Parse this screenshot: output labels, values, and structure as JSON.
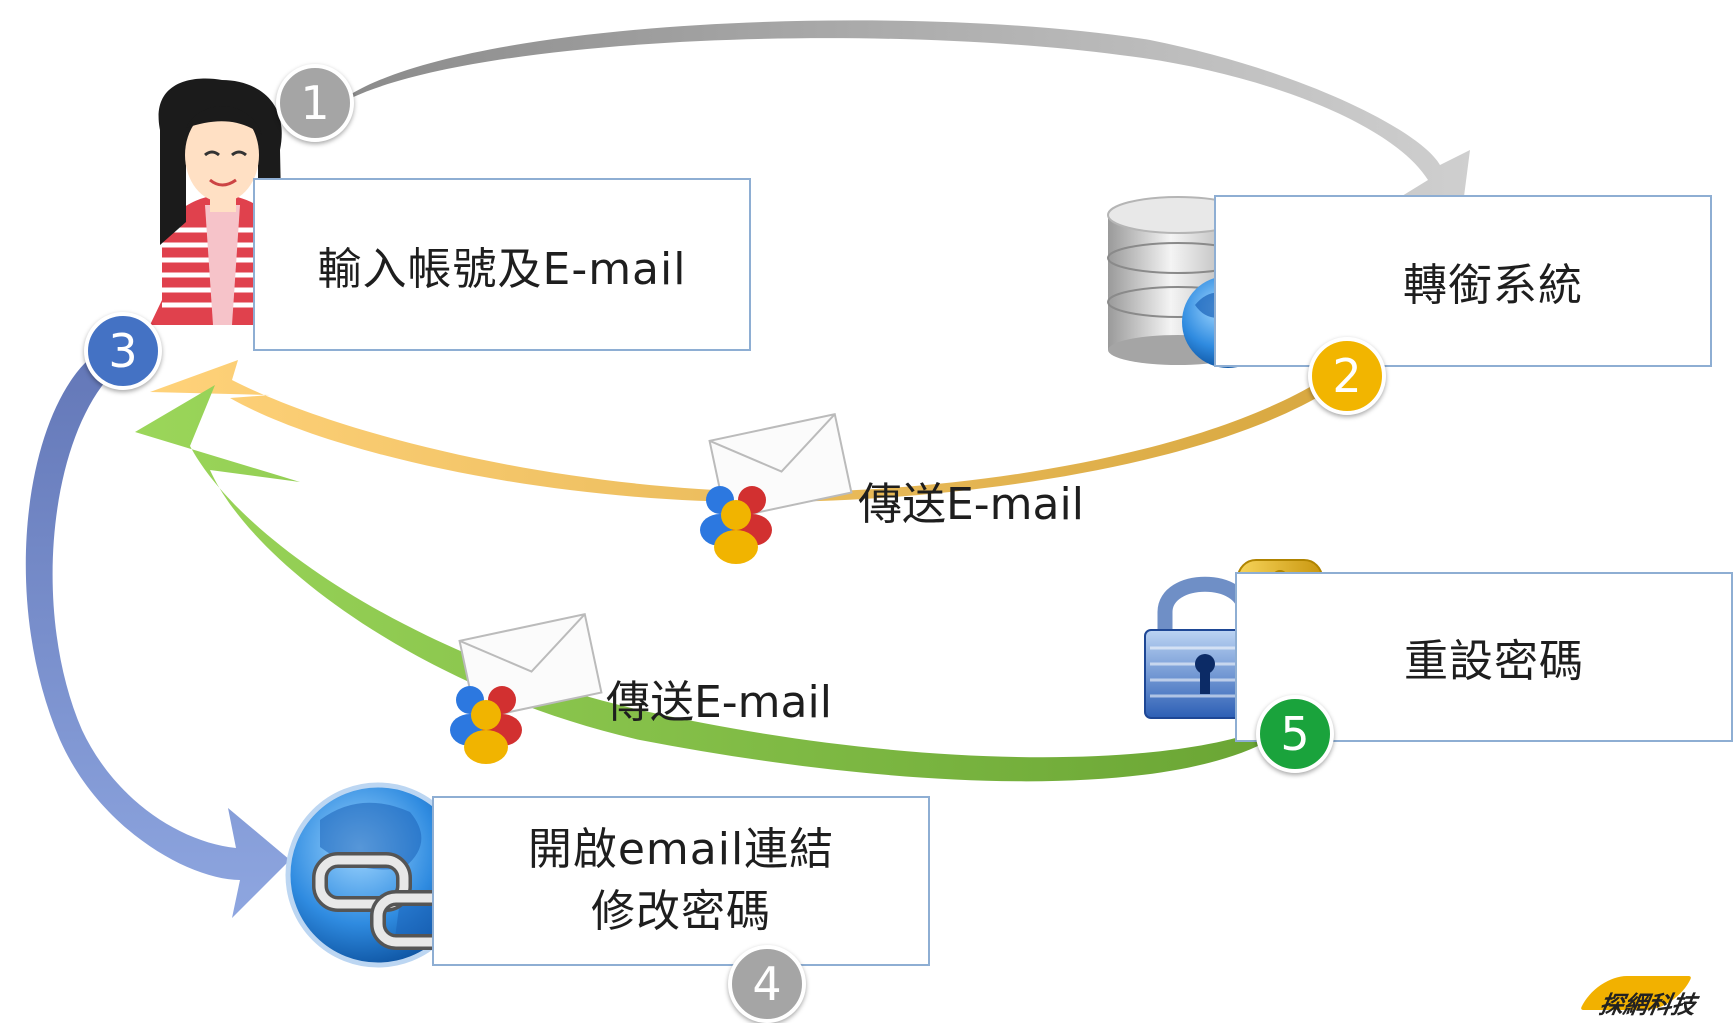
{
  "boxes": {
    "input": "輸入帳號及E-mail",
    "forward": "轉銜系統",
    "open_line1": "開啟email連結",
    "open_line2": "修改密碼",
    "reset": "重設密碼"
  },
  "arrow_labels": {
    "send_top": "傳送E-mail",
    "send_bottom": "傳送E-mail"
  },
  "steps": {
    "s1": "1",
    "s2": "2",
    "s3": "3",
    "s4": "4",
    "s5": "5"
  },
  "colors": {
    "step1": "#a5a5a5",
    "step2": "#f2b500",
    "step3": "#4472c4",
    "step4": "#a5a5a5",
    "step5": "#1aa33c",
    "box_border": "#8eaed3"
  },
  "brand": "探網科技",
  "icons": [
    "woman-user-icon",
    "database-globe-icon",
    "email-contacts-icon",
    "lock-key-icon",
    "globe-link-icon"
  ]
}
